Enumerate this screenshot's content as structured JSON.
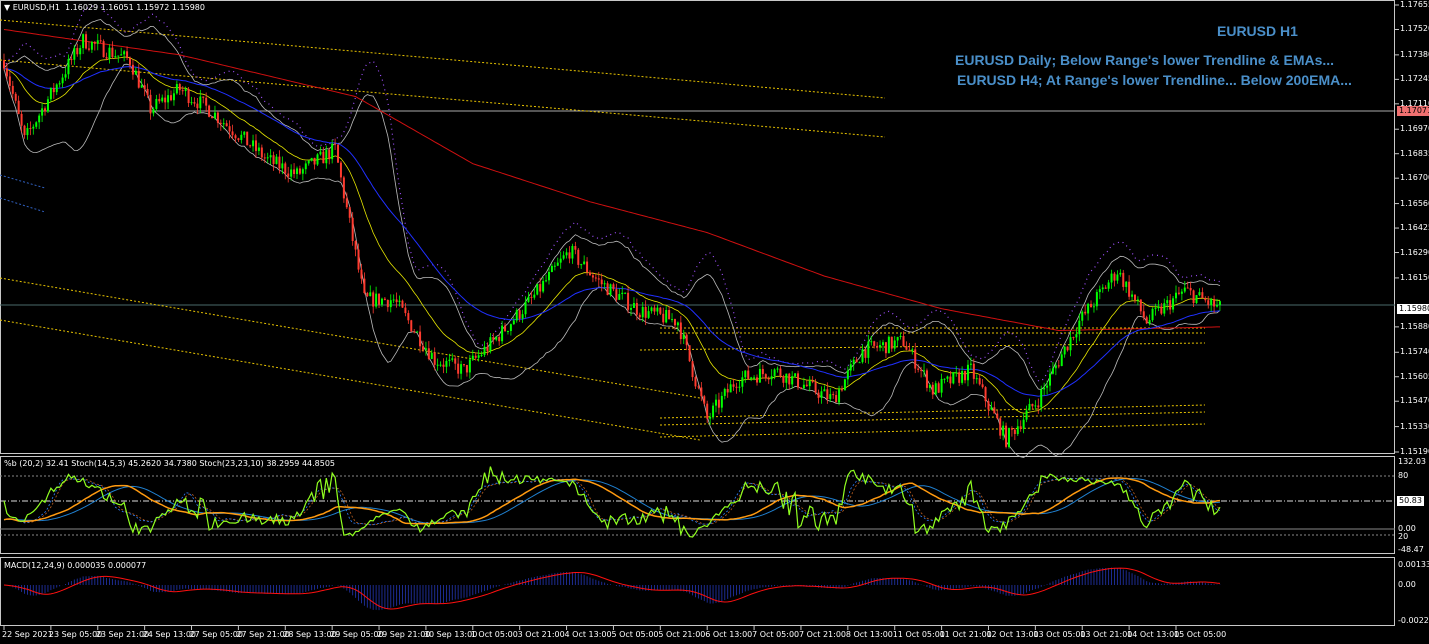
{
  "window": {
    "symbol_header": "EURUSD,H1",
    "ohlc": "1.16029 1.16051 1.15972 1.15980"
  },
  "annotations": {
    "title": "EURUSD H1",
    "line1": "EURUSD Daily; Below Range's lower Trendline & EMAs...",
    "line2": "EURUSD H4; At Range's lower Trendline... Below 200EMA..."
  },
  "colors": {
    "up": "#00ff00",
    "down": "#ff3b2f",
    "ema200": "#d01010",
    "annotation": "#4a8fc9",
    "trendline": "#e6c200"
  },
  "price_axis": {
    "labels": [
      "1.17655",
      "1.17520",
      "1.17380",
      "1.17245",
      "1.17110",
      "1.16970",
      "1.16835",
      "1.16700",
      "1.16560",
      "1.16425",
      "1.16290",
      "1.16150",
      "1.15880",
      "1.15740",
      "1.15605",
      "1.15470",
      "1.15330",
      "1.15190"
    ],
    "current_price": "1.15980",
    "line_price": "1.17071"
  },
  "time_axis": [
    "22 Sep 2021",
    "23 Sep 05:00",
    "23 Sep 21:00",
    "24 Sep 13:00",
    "27 Sep 05:00",
    "27 Sep 21:00",
    "28 Sep 13:00",
    "29 Sep 05:00",
    "29 Sep 21:00",
    "30 Sep 13:00",
    "1 Oct 05:00",
    "3 Oct 21:00",
    "4 Oct 13:00",
    "5 Oct 05:00",
    "5 Oct 21:00",
    "6 Oct 13:00",
    "7 Oct 05:00",
    "7 Oct 21:00",
    "8 Oct 13:00",
    "11 Oct 05:00",
    "11 Oct 21:00",
    "12 Oct 13:00",
    "13 Oct 05:00",
    "13 Oct 21:00",
    "14 Oct 13:00",
    "15 Oct 05:00"
  ],
  "oscillator": {
    "header": "%b (20,2) 32.41  Stoch(14,5,3) 45.2620 34.7380  Stoch(23,23,10) 38.2959 44.8505",
    "max": "132.03",
    "level80": "80",
    "current": "50.83",
    "zero": "0.00",
    "level20": "20",
    "min": "-48.47"
  },
  "macd": {
    "header": "MACD(12,24,9) 0.000035 0.000077",
    "max": "0.001332",
    "zero": "0.00",
    "min": "-0.002241"
  },
  "chart_data": {
    "type": "candlestick",
    "symbol": "EURUSD",
    "timeframe": "H1",
    "ylim": [
      1.1519,
      1.17655
    ],
    "price_path": [
      [
        0,
        1.1735
      ],
      [
        7,
        1.1691
      ],
      [
        13,
        1.1708
      ],
      [
        27,
        1.1746
      ],
      [
        43,
        1.1735
      ],
      [
        50,
        1.1708
      ],
      [
        60,
        1.1719
      ],
      [
        70,
        1.1708
      ],
      [
        90,
        1.168
      ],
      [
        100,
        1.1672
      ],
      [
        113,
        1.1686
      ],
      [
        123,
        1.1603
      ],
      [
        133,
        1.1603
      ],
      [
        147,
        1.157
      ],
      [
        157,
        1.1564
      ],
      [
        167,
        1.158
      ],
      [
        180,
        1.1603
      ],
      [
        193,
        1.163
      ],
      [
        203,
        1.1613
      ],
      [
        217,
        1.1597
      ],
      [
        230,
        1.1591
      ],
      [
        240,
        1.1537
      ],
      [
        250,
        1.1559
      ],
      [
        263,
        1.1564
      ],
      [
        283,
        1.1548
      ],
      [
        293,
        1.1575
      ],
      [
        307,
        1.158
      ],
      [
        317,
        1.1553
      ],
      [
        330,
        1.1564
      ],
      [
        342,
        1.1526
      ],
      [
        353,
        1.1548
      ],
      [
        367,
        1.1591
      ],
      [
        380,
        1.1619
      ],
      [
        390,
        1.1591
      ],
      [
        403,
        1.1608
      ],
      [
        415,
        1.1598
      ]
    ],
    "ema200_path": [
      [
        0,
        1.1752
      ],
      [
        60,
        1.1738
      ],
      [
        120,
        1.1715
      ],
      [
        160,
        1.1678
      ],
      [
        200,
        1.1657
      ],
      [
        240,
        1.164
      ],
      [
        280,
        1.1616
      ],
      [
        320,
        1.1598
      ],
      [
        360,
        1.1586
      ],
      [
        415,
        1.1588
      ]
    ]
  }
}
